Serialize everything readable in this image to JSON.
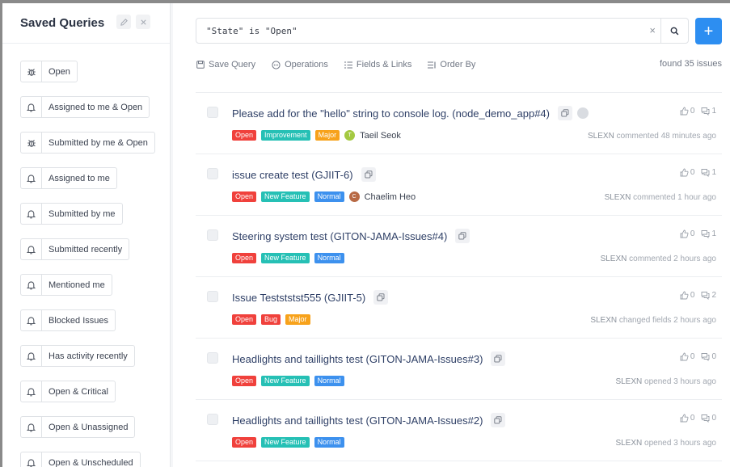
{
  "sidebar": {
    "title": "Saved Queries",
    "queries": [
      {
        "label": "Open",
        "icon": "bug-icon"
      },
      {
        "label": "Assigned to me & Open",
        "icon": "bell-icon"
      },
      {
        "label": "Submitted by me & Open",
        "icon": "bug-icon"
      },
      {
        "label": "Assigned to me",
        "icon": "bell-icon"
      },
      {
        "label": "Submitted by me",
        "icon": "bell-icon"
      },
      {
        "label": "Submitted recently",
        "icon": "bell-icon"
      },
      {
        "label": "Mentioned me",
        "icon": "bell-icon"
      },
      {
        "label": "Blocked Issues",
        "icon": "bell-icon"
      },
      {
        "label": "Has activity recently",
        "icon": "bell-icon"
      },
      {
        "label": "Open & Critical",
        "icon": "bell-icon"
      },
      {
        "label": "Open & Unassigned",
        "icon": "bell-icon"
      },
      {
        "label": "Open & Unscheduled",
        "icon": "bell-icon"
      }
    ]
  },
  "search": {
    "query": "\"State\" is \"Open\"",
    "clear_symbol": "×",
    "add_symbol": "+"
  },
  "toolbar": {
    "save_query": "Save Query",
    "operations": "Operations",
    "fields_links": "Fields & Links",
    "order_by": "Order By",
    "found": "found 35 issues"
  },
  "colors": {
    "Open": "#f0413c",
    "Improvement": "#26c0b5",
    "Major": "#f7a21b",
    "New Feature": "#26c0b5",
    "Normal": "#3d91ee",
    "Bug": "#f0413c",
    "accent": "#2d8ef1"
  },
  "issues": [
    {
      "title": "Please add for the \"hello\" string to console log. (node_demo_app#4)",
      "tags": [
        "Open",
        "Improvement",
        "Major"
      ],
      "assignee": "Taeil Seok",
      "avatar_initial": "T",
      "avatar_color": "#a4c941",
      "votes": "0",
      "comments": "1",
      "actor": "SLEXN",
      "action": " commented 48 minutes ago",
      "has_dot": true
    },
    {
      "title": "issue create test (GJIIT-6)",
      "tags": [
        "Open",
        "New Feature",
        "Normal"
      ],
      "assignee": "Chaelim Heo",
      "avatar_initial": "C",
      "avatar_color": "#b86a45",
      "votes": "0",
      "comments": "1",
      "actor": "SLEXN",
      "action": " commented 1 hour ago",
      "has_dot": false
    },
    {
      "title": "Steering system test (GITON-JAMA-Issues#4)",
      "tags": [
        "Open",
        "New Feature",
        "Normal"
      ],
      "assignee": "",
      "avatar_initial": "",
      "avatar_color": "",
      "votes": "0",
      "comments": "1",
      "actor": "SLEXN",
      "action": " commented 2 hours ago",
      "has_dot": false
    },
    {
      "title": "Issue Testststst555 (GJIIT-5)",
      "tags": [
        "Open",
        "Bug",
        "Major"
      ],
      "assignee": "",
      "avatar_initial": "",
      "avatar_color": "",
      "votes": "0",
      "comments": "2",
      "actor": "SLEXN",
      "action": " changed fields 2 hours ago",
      "has_dot": false
    },
    {
      "title": "Headlights and taillights test (GITON-JAMA-Issues#3)",
      "tags": [
        "Open",
        "New Feature",
        "Normal"
      ],
      "assignee": "",
      "avatar_initial": "",
      "avatar_color": "",
      "votes": "0",
      "comments": "0",
      "actor": "SLEXN",
      "action": " opened 3 hours ago",
      "has_dot": false
    },
    {
      "title": "Headlights and taillights test (GITON-JAMA-Issues#2)",
      "tags": [
        "Open",
        "New Feature",
        "Normal"
      ],
      "assignee": "",
      "avatar_initial": "",
      "avatar_color": "",
      "votes": "0",
      "comments": "0",
      "actor": "SLEXN",
      "action": " opened 3 hours ago",
      "has_dot": false
    }
  ]
}
